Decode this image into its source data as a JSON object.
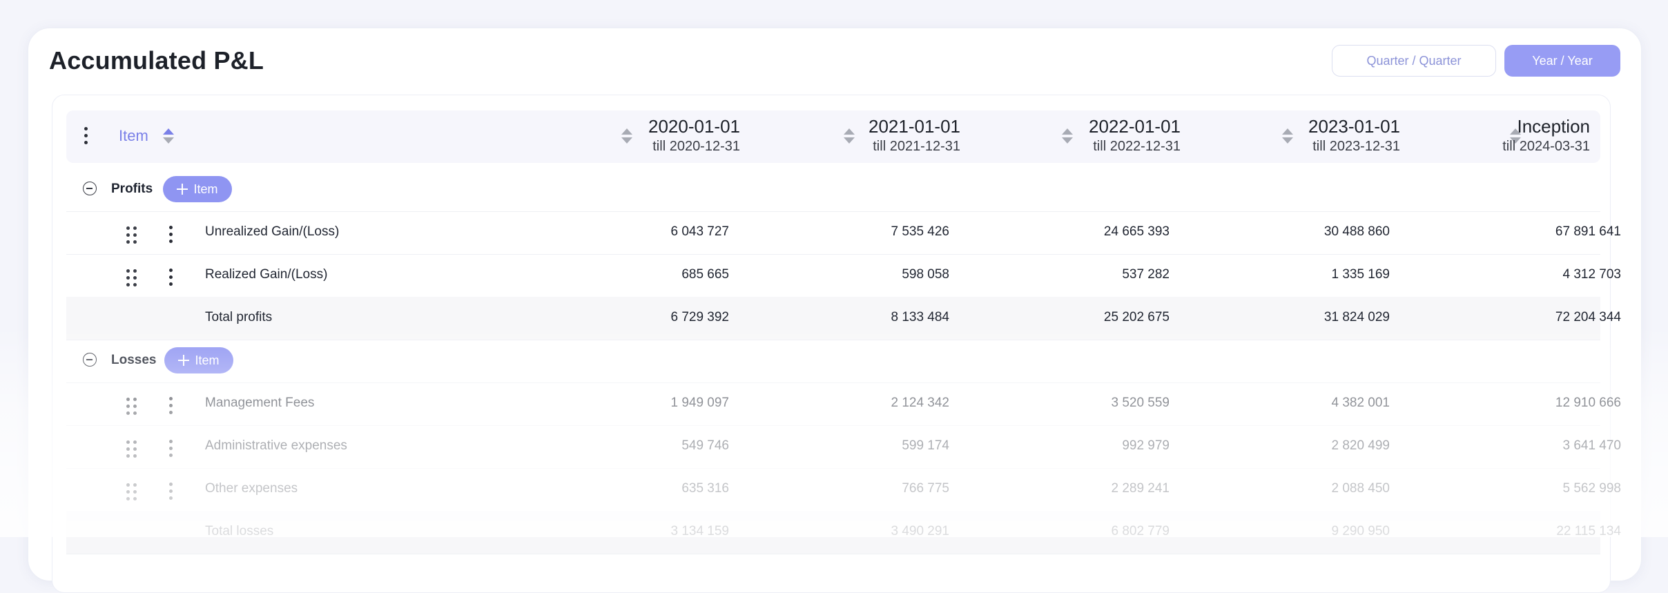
{
  "title": "Accumulated P&L",
  "toggle": {
    "quarter": "Quarter / Quarter",
    "year": "Year / Year",
    "active": "year"
  },
  "colors": {
    "accent": "#979cf4",
    "accent_text": "#7a80e8"
  },
  "header": {
    "item_label": "Item",
    "columns": [
      {
        "date": "2020-01-01",
        "till": "till 2020-12-31"
      },
      {
        "date": "2021-01-01",
        "till": "till 2021-12-31"
      },
      {
        "date": "2022-01-01",
        "till": "till 2022-12-31"
      },
      {
        "date": "2023-01-01",
        "till": "till 2023-12-31"
      },
      {
        "date": "Inception",
        "till": "till 2024-03-31"
      }
    ]
  },
  "sections": [
    {
      "name": "Profits",
      "add_label": "Item",
      "rows": [
        {
          "label": "Unrealized Gain/(Loss)",
          "values": [
            "6 043 727",
            "7 535 426",
            "24 665 393",
            "30 488 860",
            "67 891 641"
          ]
        },
        {
          "label": "Realized Gain/(Loss)",
          "values": [
            "685 665",
            "598 058",
            "537 282",
            "1 335 169",
            "4 312 703"
          ]
        }
      ],
      "total": {
        "label": "Total profits",
        "values": [
          "6 729 392",
          "8 133 484",
          "25 202 675",
          "31 824 029",
          "72 204 344"
        ]
      }
    },
    {
      "name": "Losses",
      "add_label": "Item",
      "rows": [
        {
          "label": "Management Fees",
          "values": [
            "1 949 097",
            "2 124 342",
            "3 520 559",
            "4 382 001",
            "12 910 666"
          ]
        },
        {
          "label": "Administrative expenses",
          "values": [
            "549 746",
            "599 174",
            "992 979",
            "2 820 499",
            "3 641 470"
          ]
        },
        {
          "label": "Other expenses",
          "values": [
            "635 316",
            "766 775",
            "2 289 241",
            "2 088 450",
            "5 562 998"
          ]
        }
      ],
      "total": {
        "label": "Total losses",
        "values": [
          "3 134 159",
          "3 490 291",
          "6 802 779",
          "9 290 950",
          "22 115 134"
        ]
      }
    }
  ]
}
